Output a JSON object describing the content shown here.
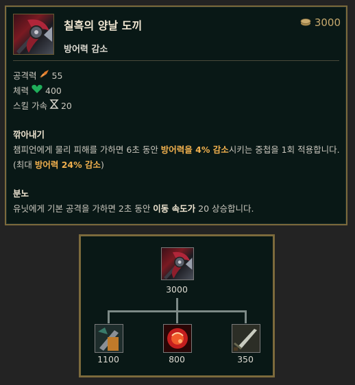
{
  "item": {
    "name": "칠흑의 양날 도끼",
    "cost": "3000",
    "subtitle": "방어력 감소",
    "icon": "black-cleaver-icon"
  },
  "stats": [
    {
      "label": "공격력",
      "icon": "attack-damage-icon",
      "value": "55"
    },
    {
      "label": "체력",
      "icon": "health-icon",
      "value": "400"
    },
    {
      "label": "스킬 가속",
      "icon": "ability-haste-icon",
      "value": "20"
    }
  ],
  "passives": [
    {
      "title": "깎아내기",
      "text_a": "챔피언에게 물리 피해를 가하면 6초 동안 ",
      "hl_a": "방어력을 4% 감소",
      "text_b": "시키는 중첩을 1회 적용합니다. (최대 ",
      "hl_b": "방어력 24% 감소",
      "text_c": ")"
    },
    {
      "title": "분노",
      "text_a": "유닛에게 기본 공격을 가하면 2초 동안 ",
      "hl_a": "이동 속도가",
      "text_b": " 20 상승합니다."
    }
  ],
  "recipe": {
    "root": {
      "cost": "3000",
      "icon": "black-cleaver-icon"
    },
    "components": [
      {
        "cost": "1100",
        "icon": "phage-icon"
      },
      {
        "cost": "800",
        "icon": "ruby-crystal-icon"
      },
      {
        "cost": "350",
        "icon": "long-sword-icon"
      }
    ]
  },
  "colors": {
    "gold": "#c8aa6e",
    "highlight": "#f1b04e",
    "background": "#091816"
  }
}
